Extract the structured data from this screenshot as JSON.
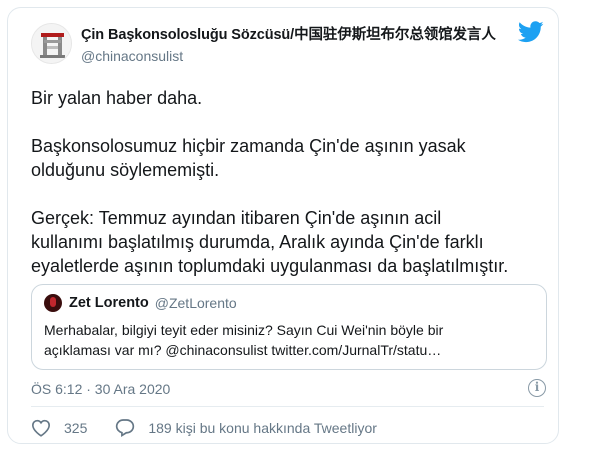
{
  "tweet": {
    "author_name": "Çin Başkonsolosluğu Sözcüsü/中国驻伊斯坦布尔总领馆发言人",
    "author_handle": "@chinaconsulist",
    "text_lines": [
      "Bir yalan haber daha.",
      "",
      "Başkonsolosumuz hiçbir zamanda Çin'de aşının yasak",
      "olduğunu söylememişti.",
      "",
      "Gerçek: Temmuz ayından itibaren Çin'de aşının acil",
      "kullanımı başlatılmış durumda, Aralık ayında Çin'de farklı",
      "eyaletlerde aşının toplumdaki uygulanması da başlatılmıştır."
    ],
    "timestamp": "ÖS 6:12 · 30 Ara 2020",
    "like_count": "325",
    "reply_text": "189 kişi bu konu hakkında Tweetliyor"
  },
  "quoted": {
    "author_name": "Zet Lorento",
    "author_handle": "@ZetLorento",
    "text_line1": "Merhabalar, bilgiyi teyit eder misiniz? Sayın Cui Wei'nin böyle bir",
    "text_line2": "açıklaması var mı? @chinaconsulist twitter.com/JurnalTr/statu…"
  },
  "colors": {
    "twitter_blue": "#1da1f2",
    "text_primary": "#14171a",
    "text_secondary": "#657786",
    "border": "#ccd6dd"
  },
  "icons": [
    "twitter-bird-icon",
    "heart-icon",
    "reply-bubble-icon",
    "info-icon"
  ]
}
